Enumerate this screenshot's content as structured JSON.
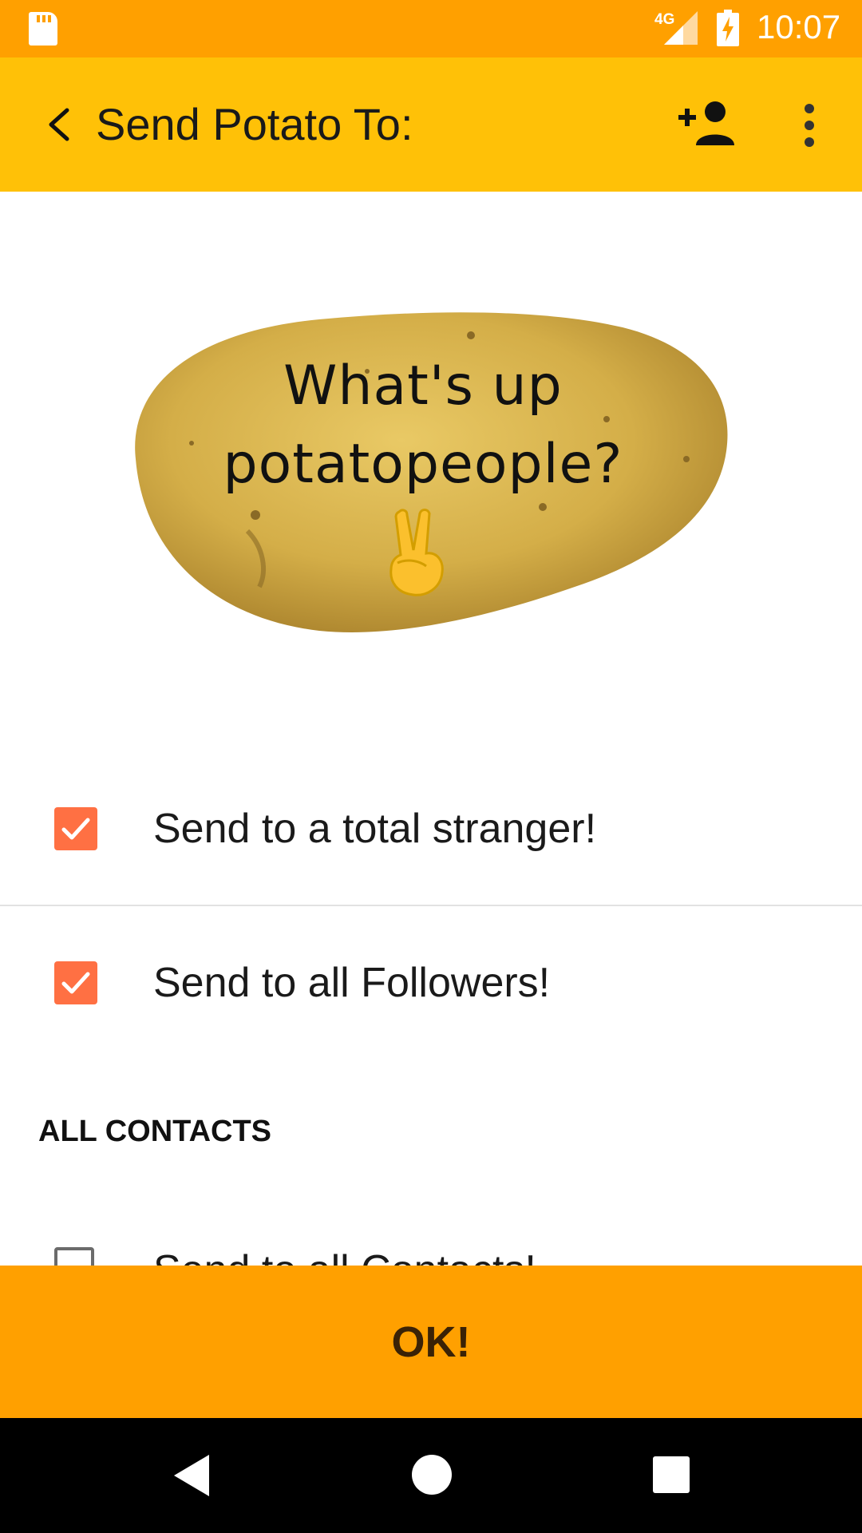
{
  "status_bar": {
    "network_label": "4G",
    "time": "10:07",
    "icons": [
      "sd-card-icon",
      "signal-icon",
      "battery-charging-icon"
    ]
  },
  "app_bar": {
    "title": "Send Potato To:",
    "icons": [
      "back-arrow-icon",
      "add-person-icon",
      "overflow-menu-icon"
    ]
  },
  "potato": {
    "message_line1": "What's up",
    "message_line2": "potatopeople?",
    "emoji": "peace-hand-icon"
  },
  "options": [
    {
      "label": "Send to a total stranger!",
      "checked": true
    },
    {
      "label": "Send to all Followers!",
      "checked": true
    }
  ],
  "contacts_section": {
    "header": "ALL CONTACTS",
    "items": [
      {
        "label": "Send to all Contacts!",
        "checked": false
      }
    ]
  },
  "ok_button": {
    "label": "OK!"
  },
  "colors": {
    "status_bar": "#FFA000",
    "app_bar": "#FFC107",
    "checkbox": "#FF7043",
    "ok_bar": "#FFA000"
  }
}
